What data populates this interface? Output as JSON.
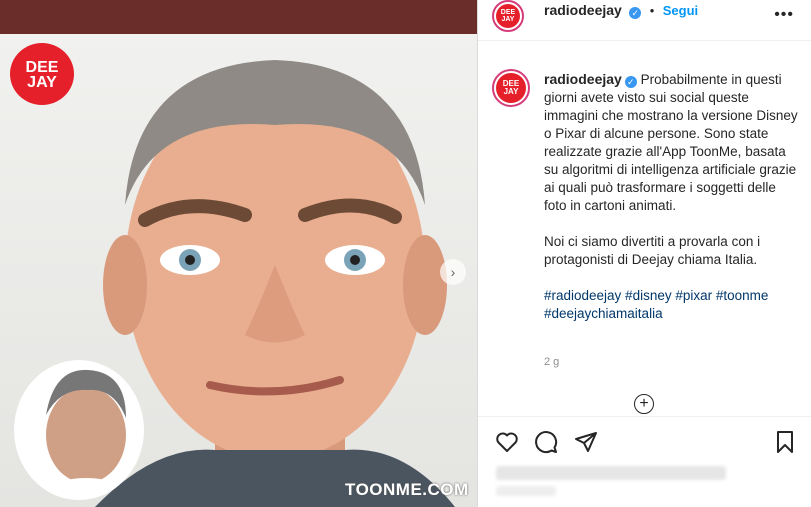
{
  "post": {
    "logo_text": "DEE JAY",
    "watermark": "TOONME.COM",
    "next_icon": "chevron-right-icon"
  },
  "header": {
    "avatar_text": "DEE JAY",
    "username": "radiodeejay",
    "verified_icon": "verified-badge-icon",
    "separator": "•",
    "follow_label": "Segui",
    "more_icon": "ellipsis-icon"
  },
  "caption": {
    "username": "radiodeejay",
    "paragraph1": "Probabilmente in questi giorni avete visto sui social queste immagini che mostrano la versione Disney o Pixar di alcune persone. Sono state realizzate grazie all'App ToonMe, basata su algoritmi di intelligenza artificiale grazie ai quali può trasformare i soggetti delle foto in cartoni animati.",
    "paragraph2": "Noi ci siamo divertiti a provarla con i protagonisti di Deejay chiama Italia.",
    "hashtags": "#radiodeejay #disney #pixar #toonme #deejaychiamaitalia",
    "time": "2 g"
  },
  "actions": {
    "like_icon": "heart-icon",
    "comment_icon": "comment-icon",
    "share_icon": "send-icon",
    "save_icon": "bookmark-icon",
    "load_more_icon": "plus-circle-icon"
  },
  "colors": {
    "brand_red": "#e5202a",
    "link_blue": "#0095f6",
    "hashtag_blue": "#00376b",
    "verified_blue": "#3897f0"
  }
}
